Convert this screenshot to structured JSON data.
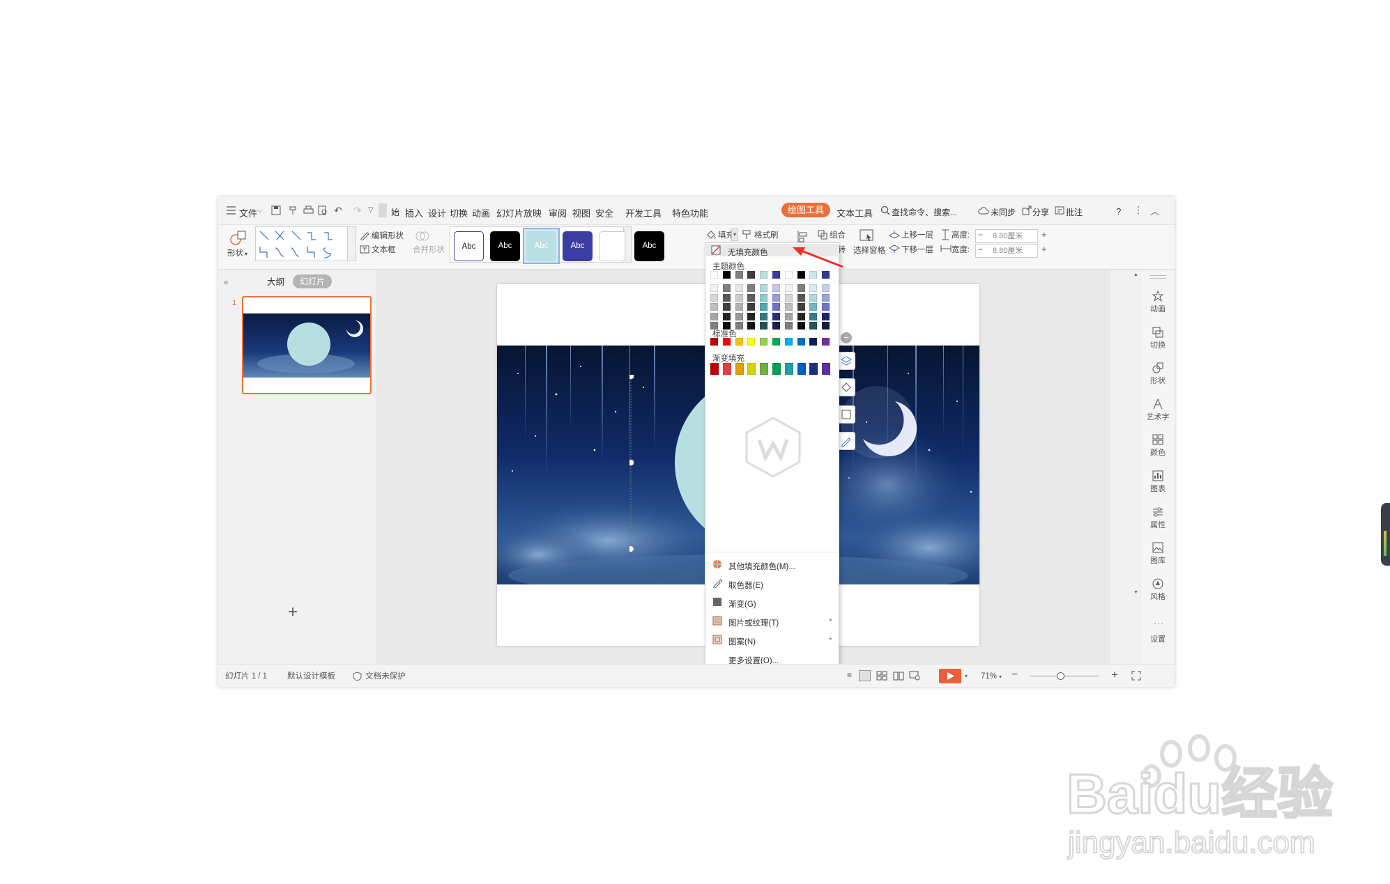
{
  "menu": {
    "file": "文件",
    "tabs": [
      "插入",
      "设计",
      "切换",
      "动画",
      "幻灯片放映",
      "审阅",
      "视图",
      "安全",
      "开发工具",
      "特色功能"
    ],
    "tab_active": "绘图工具",
    "tab_text_tools": "文本工具",
    "search": "查找命令、搜索...",
    "unsynced": "未同步",
    "share": "分享",
    "comment": "批注",
    "help": "?"
  },
  "ribbon": {
    "shape": "形状",
    "edit_shape": "编辑形状",
    "text_box": "文本框",
    "merge_shape": "合并形状",
    "style_labels": [
      "Abc",
      "Abc",
      "Abc",
      "Abc",
      "",
      "Abc"
    ],
    "fill": "填充",
    "format_painter": "格式刷",
    "group": "组合",
    "rotate": "旋转",
    "selection_pane": "选择窗格",
    "bring_forward": "上移一层",
    "send_backward": "下移一层",
    "height_label": "高度:",
    "width_label": "宽度:",
    "height_value": "8.80厘米",
    "width_value": "8.80厘米"
  },
  "leftpane": {
    "tab_outline": "大纲",
    "tab_slides": "幻灯片",
    "slide_number": "1",
    "add": "+"
  },
  "dropdown": {
    "no_fill": "无填充颜色",
    "theme_colors": "主题颜色",
    "standard_colors": "标准色",
    "gradient_fill": "渐变填充",
    "theme_top": [
      "#ffffff",
      "#000000",
      "#7f7f7f",
      "#3f3f3f",
      "#b9e0e2",
      "#3a3da1",
      "#ffffff",
      "#000000",
      "#cce8ea",
      "#2f3a8f"
    ],
    "theme_columns": [
      [
        "#f2f2f2",
        "#d8d8d8",
        "#bfbfbf",
        "#a5a5a5",
        "#7f7f7f"
      ],
      [
        "#7f7f7f",
        "#595959",
        "#3f3f3f",
        "#262626",
        "#0c0c0c"
      ],
      [
        "#e6e6e6",
        "#cccccc",
        "#b3b3b3",
        "#999999",
        "#808080"
      ],
      [
        "#7f7f7f",
        "#5f5f5f",
        "#404040",
        "#262626",
        "#141414"
      ],
      [
        "#b2dadd",
        "#8ccbcf",
        "#4fa9ae",
        "#2f7a7e",
        "#1f5155"
      ],
      [
        "#c5c6ec",
        "#9a9cdc",
        "#6e71cb",
        "#2b2d78",
        "#1d1e50"
      ],
      [
        "#f2f2f2",
        "#d8d8d8",
        "#bfbfbf",
        "#a5a5a5",
        "#7f7f7f"
      ],
      [
        "#7f7f7f",
        "#595959",
        "#3f3f3f",
        "#262626",
        "#0c0c0c"
      ],
      [
        "#d6ecee",
        "#acd9dd",
        "#6fb8be",
        "#387e84",
        "#25545a"
      ],
      [
        "#c9cdee",
        "#9ba2dd",
        "#6c76cb",
        "#1f2766",
        "#151a44"
      ]
    ],
    "standard": [
      "#c00000",
      "#ff0000",
      "#ffc000",
      "#ffff00",
      "#92d050",
      "#00b050",
      "#00b0f0",
      "#0070c0",
      "#002060",
      "#7030a0"
    ],
    "gradient": [
      "#c00000",
      "#e04040",
      "#e0a000",
      "#d4d400",
      "#70b040",
      "#00a050",
      "#20a0a0",
      "#0060c0",
      "#203080",
      "#6030a0"
    ],
    "items": [
      "其他填充颜色(M)...",
      "取色器(E)",
      "渐变(G)",
      "图片或纹理(T)",
      "图案(N)",
      "更多设置(O)..."
    ]
  },
  "rightbar": [
    "动画",
    "切换",
    "形状",
    "艺术字",
    "颜色",
    "图表",
    "属性",
    "图库",
    "风格",
    "设置"
  ],
  "status": {
    "slide_info": "幻灯片 1 / 1",
    "template": "默认设计模板",
    "protection": "文档未保护",
    "zoom": "71%"
  },
  "watermark": {
    "brand": "Baidu经验",
    "url": "jingyan.baidu.com"
  }
}
